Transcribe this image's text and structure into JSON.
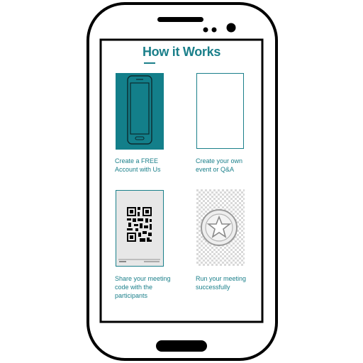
{
  "screen": {
    "title": "How it Works"
  },
  "steps": [
    {
      "caption_line1": "Create a FREE",
      "caption_line2": "Account with Us",
      "caption_line3": "",
      "icon": "phone-icon"
    },
    {
      "caption_line1": "Create your own",
      "caption_line2": "event or Q&A",
      "caption_line3": "",
      "icon": "blank-card-icon"
    },
    {
      "caption_line1": "Share your meeting",
      "caption_line2": "code with the",
      "caption_line3": "participants",
      "icon": "qr-code-icon"
    },
    {
      "caption_line1": "Run your meeting",
      "caption_line2": "successfully",
      "caption_line3": "",
      "icon": "star-badge-icon"
    }
  ],
  "colors": {
    "accent": "#1a7f8a",
    "phone_frame": "#000000"
  }
}
